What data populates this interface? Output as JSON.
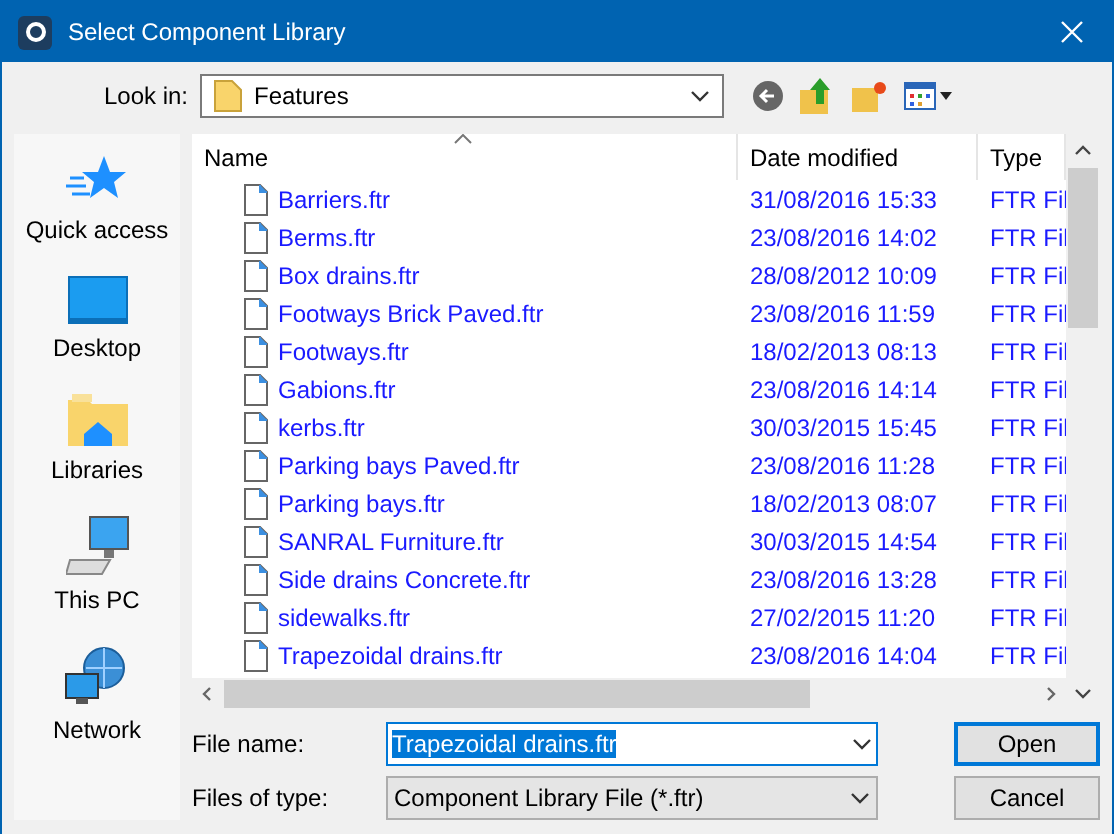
{
  "window": {
    "title": "Select Component Library"
  },
  "look_in": {
    "label": "Look in:",
    "value": "Features"
  },
  "places": [
    {
      "kind": "star",
      "label": "Quick access"
    },
    {
      "kind": "desktop",
      "label": "Desktop"
    },
    {
      "kind": "libraries",
      "label": "Libraries"
    },
    {
      "kind": "pc",
      "label": "This PC"
    },
    {
      "kind": "network",
      "label": "Network"
    }
  ],
  "table": {
    "columns": [
      "Name",
      "Date modified",
      "Type"
    ],
    "rows": [
      {
        "name": "Barriers.ftr",
        "date": "31/08/2016 15:33",
        "type": "FTR Fil"
      },
      {
        "name": "Berms.ftr",
        "date": "23/08/2016 14:02",
        "type": "FTR Fil"
      },
      {
        "name": "Box drains.ftr",
        "date": "28/08/2012 10:09",
        "type": "FTR Fil"
      },
      {
        "name": "Footways Brick Paved.ftr",
        "date": "23/08/2016 11:59",
        "type": "FTR Fil"
      },
      {
        "name": "Footways.ftr",
        "date": "18/02/2013 08:13",
        "type": "FTR Fil"
      },
      {
        "name": "Gabions.ftr",
        "date": "23/08/2016 14:14",
        "type": "FTR Fil"
      },
      {
        "name": "kerbs.ftr",
        "date": "30/03/2015 15:45",
        "type": "FTR Fil"
      },
      {
        "name": "Parking bays Paved.ftr",
        "date": "23/08/2016 11:28",
        "type": "FTR Fil"
      },
      {
        "name": "Parking bays.ftr",
        "date": "18/02/2013 08:07",
        "type": "FTR Fil"
      },
      {
        "name": "SANRAL Furniture.ftr",
        "date": "30/03/2015 14:54",
        "type": "FTR Fil"
      },
      {
        "name": "Side drains Concrete.ftr",
        "date": "23/08/2016 13:28",
        "type": "FTR Fil"
      },
      {
        "name": "sidewalks.ftr",
        "date": "27/02/2015 11:20",
        "type": "FTR Fil"
      },
      {
        "name": "Trapezoidal drains.ftr",
        "date": "23/08/2016 14:04",
        "type": "FTR Fil"
      }
    ]
  },
  "file_name": {
    "label": "File name:",
    "value": "Trapezoidal drains.ftr",
    "text_selected": true
  },
  "file_type": {
    "label": "Files of type:",
    "value": "Component Library File (*.ftr)"
  },
  "buttons": [
    {
      "label": "Open",
      "default": true
    },
    {
      "label": "Cancel",
      "default": false
    }
  ]
}
